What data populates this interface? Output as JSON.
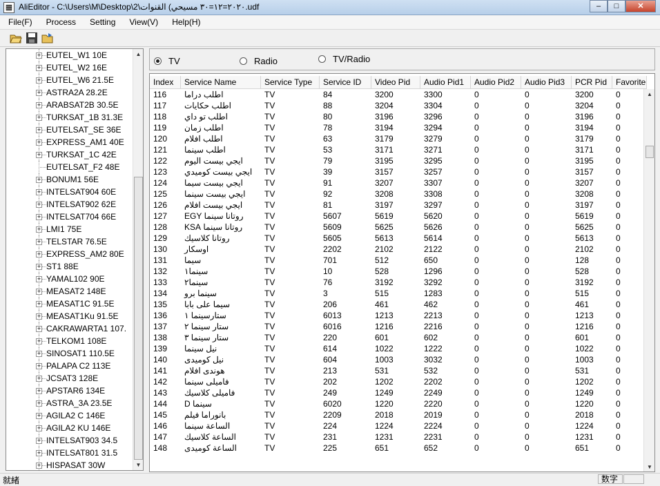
{
  "window": {
    "title": "AliEditor - C:\\Users\\M\\Desktop\\2\\٢٠٢٠=١٢=٣٠ مسيحي) القنوات.udf",
    "buttons": {
      "minimize": "–",
      "maximize": "□",
      "close": "✕"
    }
  },
  "menu": [
    "File(F)",
    "Process",
    "Setting",
    "View(V)",
    "Help(H)"
  ],
  "toolbar": {
    "icons": [
      "open-folder-icon",
      "save-icon",
      "open-file-icon"
    ]
  },
  "tree": {
    "items": [
      {
        "label": "EUTEL_W1 10E",
        "expandable": true
      },
      {
        "label": "EUTEL_W2 16E",
        "expandable": true
      },
      {
        "label": "EUTEL_W6 21.5E",
        "expandable": true
      },
      {
        "label": "ASTRA2A 28.2E",
        "expandable": true
      },
      {
        "label": "ARABSAT2B 30.5E",
        "expandable": true
      },
      {
        "label": "TURKSAT_1B 31.3E",
        "expandable": true
      },
      {
        "label": "EUTELSAT_SE 36E",
        "expandable": true
      },
      {
        "label": "EXPRESS_AM1 40E",
        "expandable": true
      },
      {
        "label": "TURKSAT_1C 42E",
        "expandable": true
      },
      {
        "label": "EUTELSAT_F2 48E",
        "expandable": false
      },
      {
        "label": "BONUM1 56E",
        "expandable": true
      },
      {
        "label": "INTELSAT904 60E",
        "expandable": true
      },
      {
        "label": "INTELSAT902 62E",
        "expandable": true
      },
      {
        "label": "INTELSAT704 66E",
        "expandable": true
      },
      {
        "label": "LMI1 75E",
        "expandable": true
      },
      {
        "label": "TELSTAR 76.5E",
        "expandable": true
      },
      {
        "label": "EXPRESS_AM2 80E",
        "expandable": true
      },
      {
        "label": "ST1 88E",
        "expandable": true
      },
      {
        "label": "YAMAL102 90E",
        "expandable": true
      },
      {
        "label": "MEASAT2 148E",
        "expandable": true
      },
      {
        "label": "MEASAT1C 91.5E",
        "expandable": true
      },
      {
        "label": "MEASAT1Ku 91.5E",
        "expandable": true
      },
      {
        "label": "CAKRAWARTA1 107.",
        "expandable": true
      },
      {
        "label": "TELKOM1 108E",
        "expandable": true
      },
      {
        "label": "SINOSAT1 110.5E",
        "expandable": true
      },
      {
        "label": "PALAPA C2 113E",
        "expandable": true
      },
      {
        "label": "JCSAT3 128E",
        "expandable": true
      },
      {
        "label": "APSTAR6 134E",
        "expandable": true
      },
      {
        "label": "ASTRA_3A 23.5E",
        "expandable": true
      },
      {
        "label": "AGILA2 C 146E",
        "expandable": true
      },
      {
        "label": "AGILA2 KU 146E",
        "expandable": true
      },
      {
        "label": "INTELSAT903 34.5",
        "expandable": true
      },
      {
        "label": "INTELSAT801 31.5",
        "expandable": true
      },
      {
        "label": "HISPASAT 30W",
        "expandable": true
      }
    ],
    "scroll_arrows": {
      "up": "▲",
      "down": "▼"
    }
  },
  "radio": {
    "options": [
      {
        "label": "TV",
        "selected": true
      },
      {
        "label": "Radio",
        "selected": false
      },
      {
        "label": "TV/Radio",
        "selected": false
      }
    ]
  },
  "grid": {
    "columns": [
      "Index",
      "Service Name",
      "Service Type",
      "Service ID",
      "Video Pid",
      "Audio Pid1",
      "Audio Pid2",
      "Audio Pid3",
      "PCR Pid",
      "Favorite"
    ],
    "rows": [
      [
        "116",
        "اطلب دراما",
        "TV",
        "84",
        "3200",
        "3300",
        "0",
        "0",
        "3200",
        "0"
      ],
      [
        "117",
        "اطلب حكايات",
        "TV",
        "88",
        "3204",
        "3304",
        "0",
        "0",
        "3204",
        "0"
      ],
      [
        "118",
        "اطلب تو داي",
        "TV",
        "80",
        "3196",
        "3296",
        "0",
        "0",
        "3196",
        "0"
      ],
      [
        "119",
        "اطلب زمان",
        "TV",
        "78",
        "3194",
        "3294",
        "0",
        "0",
        "3194",
        "0"
      ],
      [
        "120",
        "اطلب افلام",
        "TV",
        "63",
        "3179",
        "3279",
        "0",
        "0",
        "3179",
        "0"
      ],
      [
        "121",
        "اطلب سينما",
        "TV",
        "53",
        "3171",
        "3271",
        "0",
        "0",
        "3171",
        "0"
      ],
      [
        "122",
        "ايجي بيست اليوم",
        "TV",
        "79",
        "3195",
        "3295",
        "0",
        "0",
        "3195",
        "0"
      ],
      [
        "123",
        "ايجي بيست كوميدي",
        "TV",
        "39",
        "3157",
        "3257",
        "0",
        "0",
        "3157",
        "0"
      ],
      [
        "124",
        "ايجي بيست سيما",
        "TV",
        "91",
        "3207",
        "3307",
        "0",
        "0",
        "3207",
        "0"
      ],
      [
        "125",
        "ايجي بيست سينما",
        "TV",
        "92",
        "3208",
        "3308",
        "0",
        "0",
        "3208",
        "0"
      ],
      [
        "126",
        "ايجي بيست افلام",
        "TV",
        "81",
        "3197",
        "3297",
        "0",
        "0",
        "3197",
        "0"
      ],
      [
        "127",
        "روتانا سينما EGY",
        "TV",
        "5607",
        "5619",
        "5620",
        "0",
        "0",
        "5619",
        "0"
      ],
      [
        "128",
        "روتانا سينما KSA",
        "TV",
        "5609",
        "5625",
        "5626",
        "0",
        "0",
        "5625",
        "0"
      ],
      [
        "129",
        "روتانا كلاسيك",
        "TV",
        "5605",
        "5613",
        "5614",
        "0",
        "0",
        "5613",
        "0"
      ],
      [
        "130",
        "اوسكار",
        "TV",
        "2202",
        "2102",
        "2122",
        "0",
        "0",
        "2102",
        "0"
      ],
      [
        "131",
        "سيما",
        "TV",
        "701",
        "512",
        "650",
        "0",
        "0",
        "128",
        "0"
      ],
      [
        "132",
        "سينما١",
        "TV",
        "10",
        "528",
        "1296",
        "0",
        "0",
        "528",
        "0"
      ],
      [
        "133",
        "سينما٢",
        "TV",
        "76",
        "3192",
        "3292",
        "0",
        "0",
        "3192",
        "0"
      ],
      [
        "134",
        "سينما برو",
        "TV",
        "3",
        "515",
        "1283",
        "0",
        "0",
        "515",
        "0"
      ],
      [
        "135",
        "سيما على بابا",
        "TV",
        "206",
        "461",
        "462",
        "0",
        "0",
        "461",
        "0"
      ],
      [
        "136",
        "ستارسينما ١",
        "TV",
        "6013",
        "1213",
        "2213",
        "0",
        "0",
        "1213",
        "0"
      ],
      [
        "137",
        "ستار سينما ٢",
        "TV",
        "6016",
        "1216",
        "2216",
        "0",
        "0",
        "1216",
        "0"
      ],
      [
        "138",
        "ستار سينما ٣",
        "TV",
        "220",
        "601",
        "602",
        "0",
        "0",
        "601",
        "0"
      ],
      [
        "139",
        "نيل سينما",
        "TV",
        "614",
        "1022",
        "1222",
        "0",
        "0",
        "1022",
        "0"
      ],
      [
        "140",
        "نيل كوميدى",
        "TV",
        "604",
        "1003",
        "3032",
        "0",
        "0",
        "1003",
        "0"
      ],
      [
        "141",
        "هوندى افلام",
        "TV",
        "213",
        "531",
        "532",
        "0",
        "0",
        "531",
        "0"
      ],
      [
        "142",
        "فاميلى سينما",
        "TV",
        "202",
        "1202",
        "2202",
        "0",
        "0",
        "1202",
        "0"
      ],
      [
        "143",
        "فاميلى كلاسيك",
        "TV",
        "249",
        "1249",
        "2249",
        "0",
        "0",
        "1249",
        "0"
      ],
      [
        "144",
        "سينما D",
        "TV",
        "6020",
        "1220",
        "2220",
        "0",
        "0",
        "1220",
        "0"
      ],
      [
        "145",
        "بانوراما فيلم",
        "TV",
        "2209",
        "2018",
        "2019",
        "0",
        "0",
        "2018",
        "0"
      ],
      [
        "146",
        "الساعة سينما",
        "TV",
        "224",
        "1224",
        "2224",
        "0",
        "0",
        "1224",
        "0"
      ],
      [
        "147",
        "الساعة كلاسيك",
        "TV",
        "231",
        "1231",
        "2231",
        "0",
        "0",
        "1231",
        "0"
      ],
      [
        "148",
        "الساعة كوميدى",
        "TV",
        "225",
        "651",
        "652",
        "0",
        "0",
        "651",
        "0"
      ]
    ],
    "scroll_arrows": {
      "up": "▲",
      "down": "▼"
    }
  },
  "status": {
    "left": "就緒",
    "pane": "数字"
  }
}
